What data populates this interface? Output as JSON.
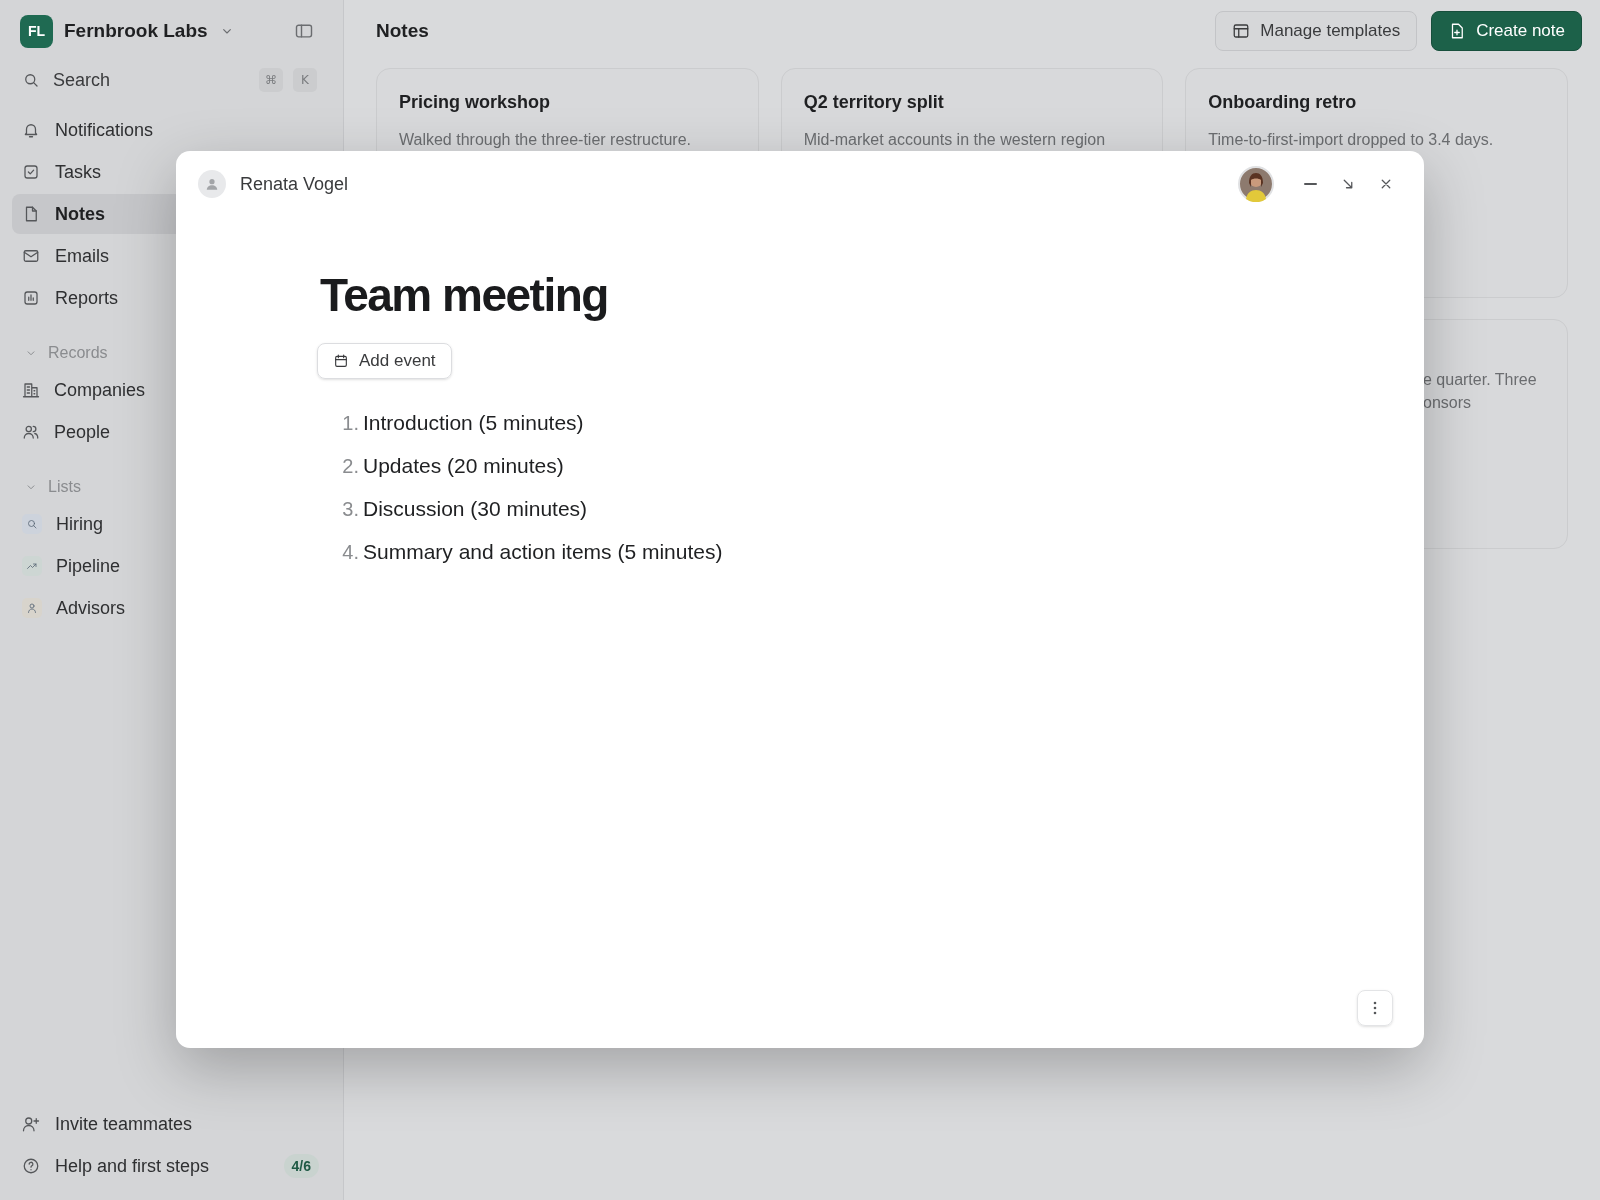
{
  "workspace": {
    "initials": "FL",
    "name": "Fernbrook Labs"
  },
  "search": {
    "placeholder": "Search",
    "shortcut": [
      "⌘",
      "K"
    ]
  },
  "nav": [
    {
      "label": "Notifications",
      "kind": "bell",
      "selected": false
    },
    {
      "label": "Tasks",
      "kind": "check",
      "selected": false
    },
    {
      "label": "Notes",
      "kind": "note",
      "selected": true
    },
    {
      "label": "Emails",
      "kind": "mail",
      "selected": false
    },
    {
      "label": "Reports",
      "kind": "chart",
      "selected": false
    }
  ],
  "sections": [
    {
      "title": "Records",
      "expanded": true,
      "items": [
        {
          "label": "Companies",
          "kind": "building"
        },
        {
          "label": "People",
          "kind": "people"
        }
      ]
    },
    {
      "title": "Lists",
      "expanded": true,
      "items": [
        {
          "label": "Hiring",
          "kind": "search",
          "color": "#cdd3dc"
        },
        {
          "label": "Pipeline",
          "kind": "trend",
          "color": "#cdd6d3"
        },
        {
          "label": "Advisors",
          "kind": "person",
          "color": "#d8d4cc"
        }
      ]
    }
  ],
  "footer": [
    {
      "label": "Invite teammates",
      "kind": "invite"
    },
    {
      "label": "Help and first steps",
      "kind": "help",
      "badge": "4/6"
    }
  ],
  "header": {
    "title": "Notes",
    "actions": [
      {
        "label": "Manage templates",
        "kind": "secondary"
      },
      {
        "label": "Create note",
        "kind": "primary"
      }
    ]
  },
  "cards": [
    {
      "title": "Pricing workshop",
      "lines": [
        "Walked through the three-tier restructure."
      ]
    },
    {
      "title": "Q2 territory split",
      "lines": [
        "Mid-market accounts in the western region"
      ]
    },
    {
      "title": "Onboarding retro",
      "lines": [
        "Time-to-first-import dropped to 3.4 days."
      ]
    },
    {
      "lines": [
        "e quarter. Three",
        "onsors"
      ]
    }
  ],
  "note": {
    "owner": "Renata Vogel",
    "title": "Team meeting",
    "event_button": "Add event",
    "agenda": [
      {
        "number": "1.",
        "text": "Introduction (5 minutes)"
      },
      {
        "number": "2.",
        "text": "Updates (20 minutes)"
      },
      {
        "number": "3.",
        "text": "Discussion (30 minutes)"
      },
      {
        "number": "4.",
        "text": "Summary and action items (5 minutes)"
      }
    ]
  }
}
